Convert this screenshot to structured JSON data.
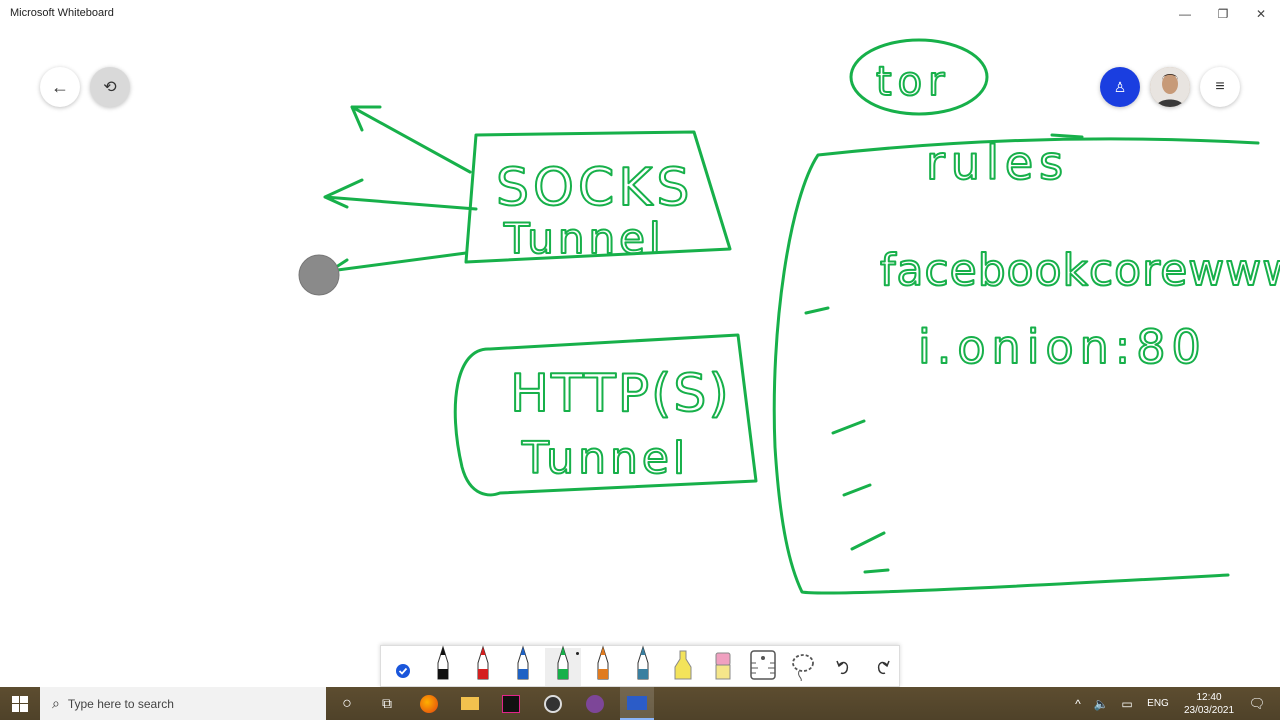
{
  "window": {
    "title": "Microsoft Whiteboard",
    "minimize_glyph": "—",
    "restore_glyph": "❐",
    "close_glyph": "✕"
  },
  "whiteboard": {
    "back_icon": "arrow-left-icon",
    "history_icon": "history-icon",
    "invite_icon": "person-add-icon",
    "menu_icon": "hamburger-icon",
    "ink_color": "#17b04a",
    "handwriting": {
      "tor": "tor",
      "socks_line1": "SOCKS",
      "socks_line2": "Tunnel",
      "http_line1": "HTTP(S)",
      "http_line2": "Tunnel",
      "rules": "rules",
      "rule1": "facebookcorewwwi",
      "rule2": "i.onion:80"
    }
  },
  "toolbar": {
    "tools": [
      {
        "name": "select-tool",
        "icon": "check-circle-icon",
        "color": "#1a56db"
      },
      {
        "name": "pen-black",
        "icon": "pen-icon",
        "color": "#111111"
      },
      {
        "name": "pen-red",
        "icon": "pen-icon",
        "color": "#d42020"
      },
      {
        "name": "pen-blue",
        "icon": "pen-icon",
        "color": "#1f62c4"
      },
      {
        "name": "pen-green",
        "icon": "pen-icon",
        "color": "#17b04a"
      },
      {
        "name": "pen-rainbow",
        "icon": "pen-icon",
        "color": "#e07b20"
      },
      {
        "name": "pen-galaxy",
        "icon": "pen-icon",
        "color": "#3a7fa0"
      },
      {
        "name": "highlighter",
        "icon": "highlighter-icon",
        "color": "#f3e35a"
      },
      {
        "name": "eraser",
        "icon": "eraser-icon",
        "color": "#f0a0c0"
      },
      {
        "name": "ruler",
        "icon": "ruler-icon",
        "color": "#555555"
      },
      {
        "name": "lasso",
        "icon": "lasso-icon",
        "color": "#555555"
      },
      {
        "name": "undo",
        "icon": "undo-icon",
        "color": "#333333"
      },
      {
        "name": "redo",
        "icon": "redo-icon",
        "color": "#333333"
      }
    ]
  },
  "taskbar": {
    "search_placeholder": "Type here to search",
    "language": "ENG",
    "time": "12:40",
    "date": "23/03/2021"
  }
}
